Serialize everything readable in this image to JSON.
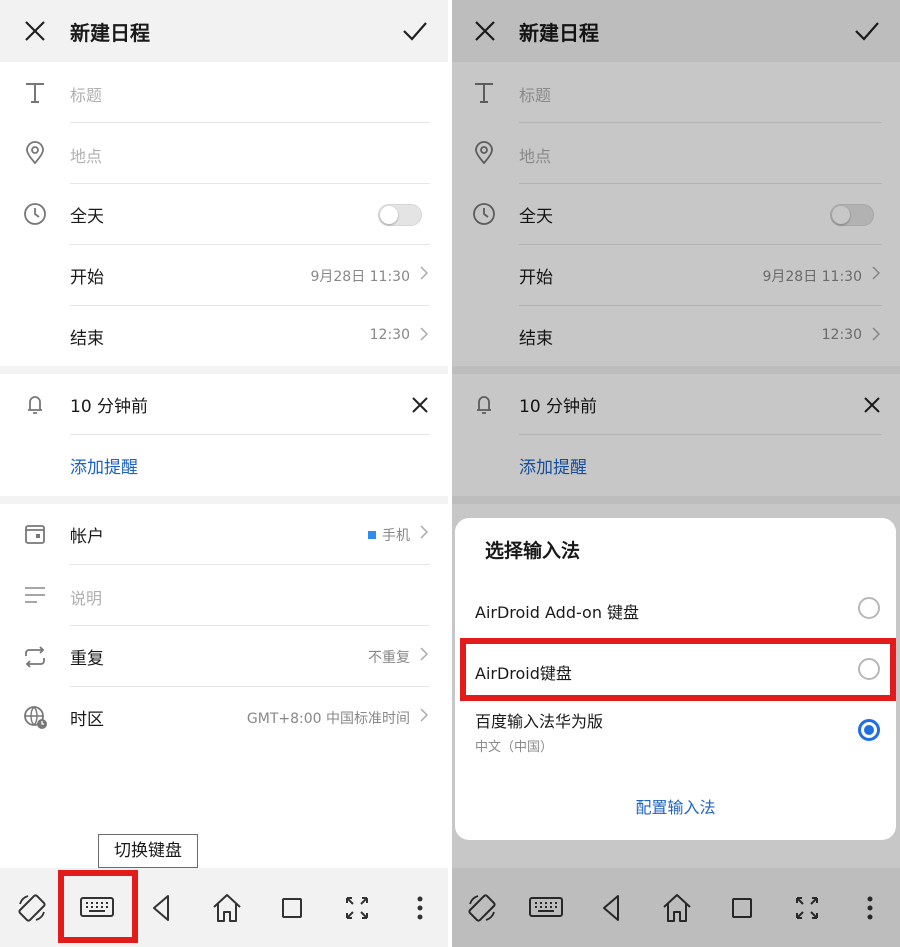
{
  "form": {
    "title": "新建日程",
    "title_placeholder": "标题",
    "location_placeholder": "地点",
    "all_day_label": "全天",
    "all_day_on": false,
    "start_label": "开始",
    "start_value": "9月28日 11:30",
    "end_label": "结束",
    "end_value": "12:30",
    "reminder_text": "10 分钟前",
    "add_reminder": "添加提醒",
    "account_label": "帐户",
    "account_value": "手机",
    "description_placeholder": "说明",
    "repeat_label": "重复",
    "repeat_value": "不重复",
    "timezone_label": "时区",
    "timezone_value": "GMT+8:00 中国标准时间"
  },
  "tooltip": "切换键盘",
  "nav_icons": [
    "rotate-screen-icon",
    "keyboard-icon",
    "back-icon",
    "home-icon",
    "recents-icon",
    "fullscreen-icon",
    "more-icon"
  ],
  "dialog": {
    "title": "选择输入法",
    "options": [
      {
        "name": "AirDroid Add-on 键盘",
        "sub": "",
        "selected": false
      },
      {
        "name": "AirDroid键盘",
        "sub": "",
        "selected": false
      },
      {
        "name": "百度输入法华为版",
        "sub": "中文（中国）",
        "selected": true
      }
    ],
    "configure": "配置输入法"
  },
  "colors": {
    "accent_blue": "#1e63c4",
    "highlight_red": "#e21b1b",
    "radio_selected": "#1e6fe0"
  }
}
